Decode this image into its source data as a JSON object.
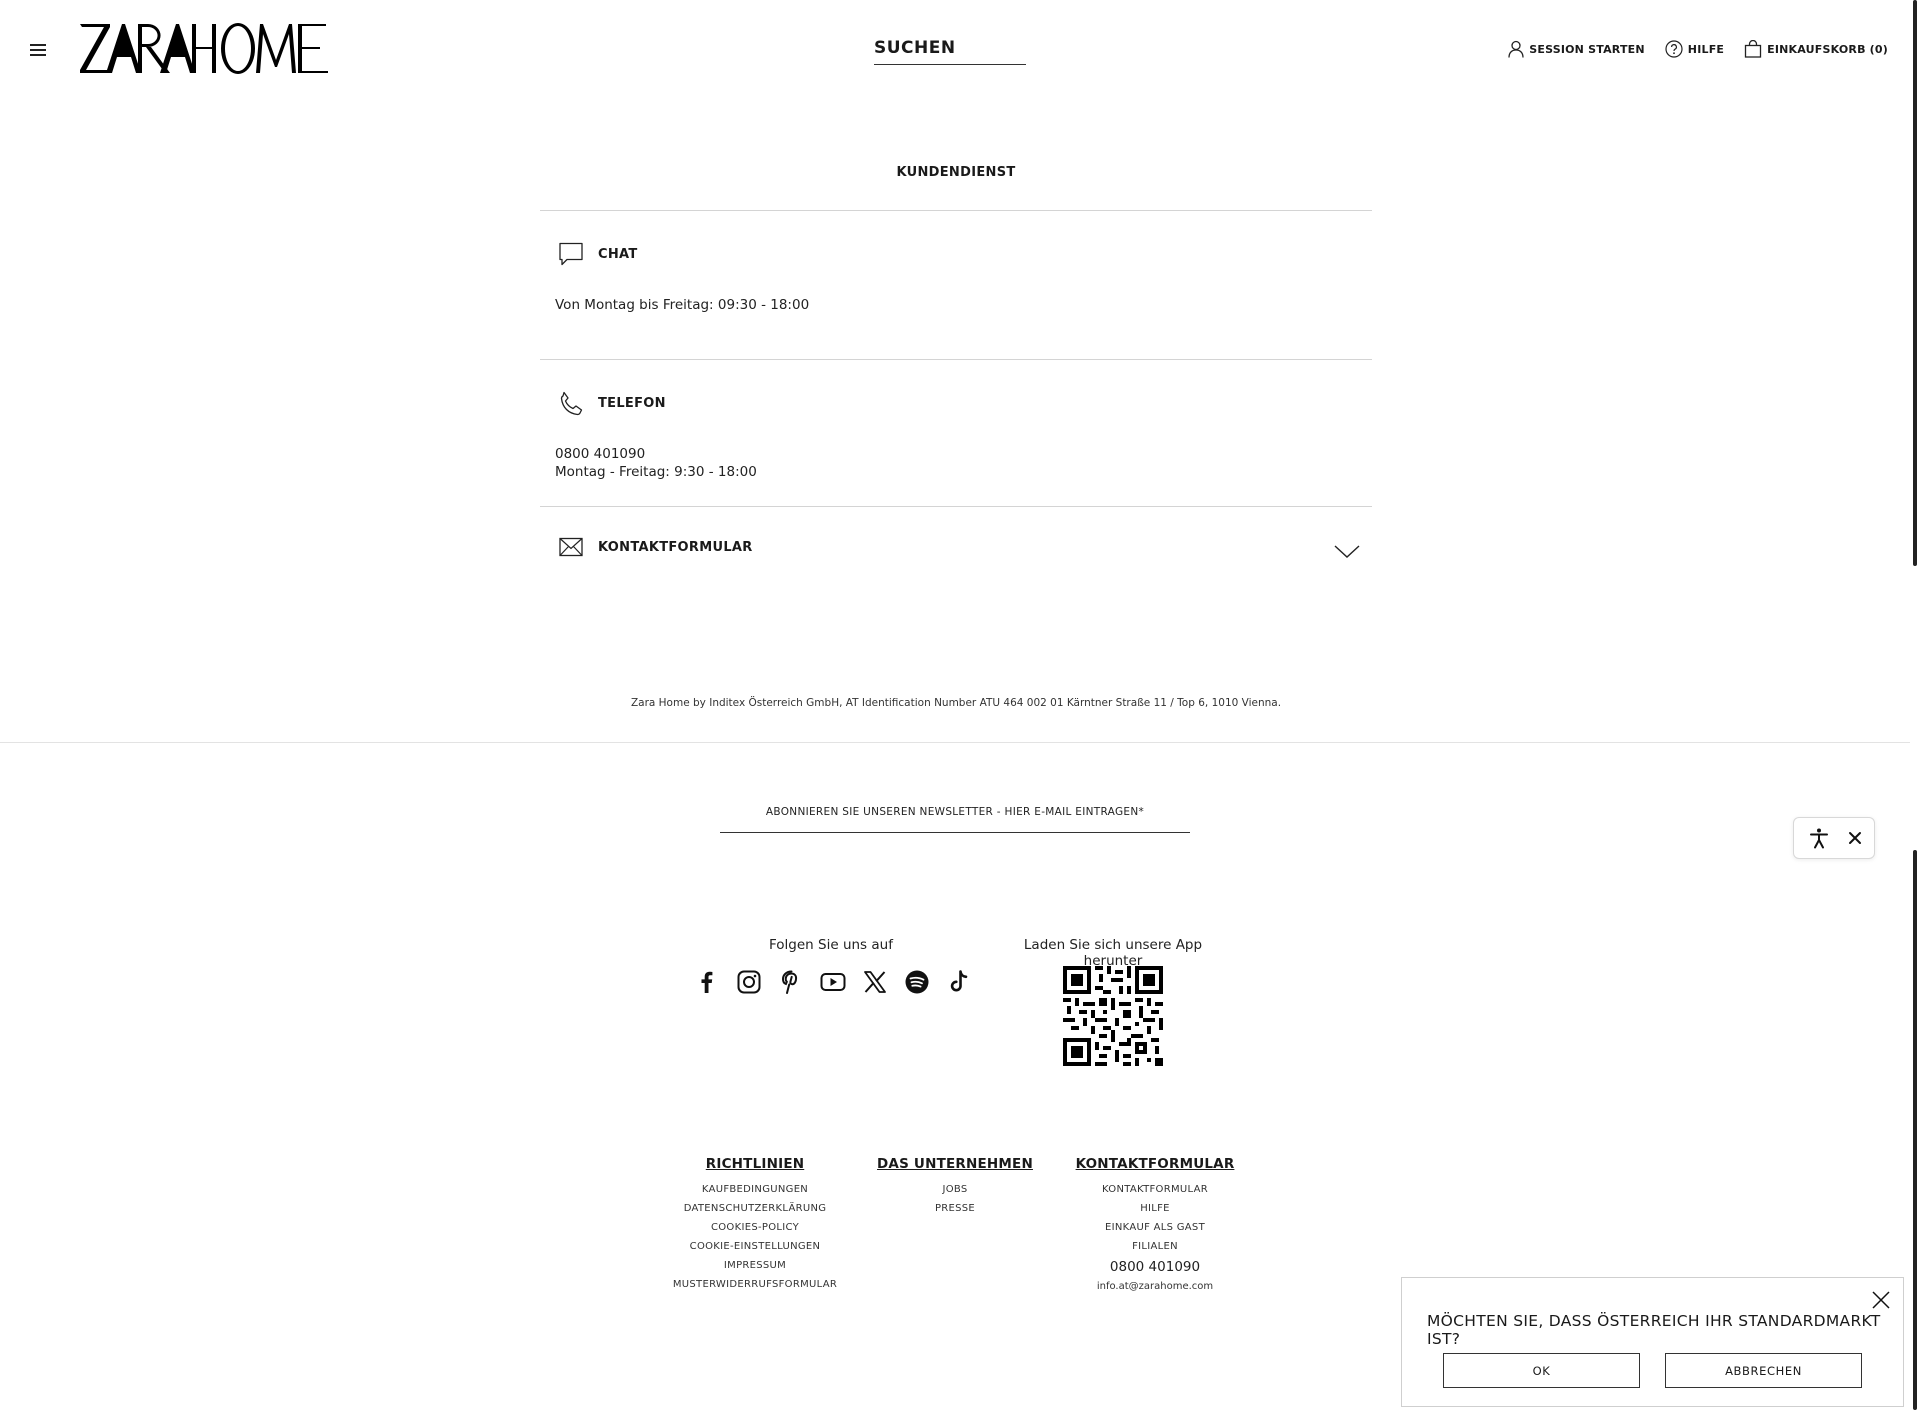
{
  "header": {
    "logo_alt": "ZARA HOME",
    "search_label": "SUCHEN",
    "nav": {
      "login": "SESSION STARTEN",
      "help": "HILFE",
      "cart": "EINKAUFSKORB (0)"
    }
  },
  "contact": {
    "title": "KUNDENDIENST",
    "chat": {
      "label": "CHAT",
      "hours": "Von Montag bis Freitag: 09:30 - 18:00"
    },
    "phone": {
      "label": "TELEFON",
      "number": "0800 401090",
      "hours": "Montag - Freitag: 9:30 - 18:00"
    },
    "form": {
      "label": "KONTAKTFORMULAR"
    }
  },
  "company_info": "Zara Home by Inditex Österreich GmbH, AT Identification Number ATU 464 002 01 Kärntner Straße 11 / Top 6, 1010 Vienna.",
  "newsletter": {
    "placeholder": "ABONNIEREN SIE UNSEREN NEWSLETTER - HIER E-MAIL EINTRAGEN*"
  },
  "social": {
    "title": "Folgen Sie uns auf",
    "icons": [
      "facebook-icon",
      "instagram-icon",
      "pinterest-icon",
      "youtube-icon",
      "x-icon",
      "spotify-icon",
      "tiktok-icon"
    ]
  },
  "app": {
    "title": "Laden Sie sich unsere App herunter"
  },
  "footer": {
    "columns": [
      {
        "heading": "RICHTLINIEN",
        "links": [
          "KAUFBEDINGUNGEN",
          "DATENSCHUTZERKLÄRUNG",
          "COOKIES-POLICY",
          "COOKIE-EINSTELLUNGEN",
          "IMPRESSUM",
          "MUSTERWIDERRUFSFORMULAR"
        ]
      },
      {
        "heading": "DAS UNTERNEHMEN",
        "links": [
          "JOBS",
          "PRESSE"
        ]
      },
      {
        "heading": "KONTAKTFORMULAR",
        "links": [
          "KONTAKTFORMULAR",
          "HILFE",
          "EINKAUF ALS GAST",
          "FILIALEN"
        ],
        "phone": "0800 401090",
        "email": "info.at@zarahome.com"
      }
    ]
  },
  "market_popup": {
    "question": "MÖCHTEN SIE, DASS ÖSTERREICH IHR STANDARDMARKT IST?",
    "ok_label": "OK",
    "cancel_label": "ABBRECHEN"
  },
  "colors": {
    "text": "#1a1a1a",
    "divider": "#d4d4d4",
    "background": "#ffffff"
  }
}
